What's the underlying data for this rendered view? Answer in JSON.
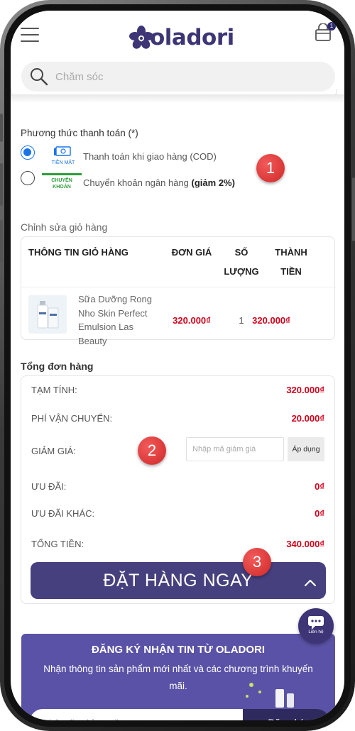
{
  "header": {
    "logo_text": "oladori",
    "cart_count": "1",
    "search_placeholder": "Chăm sóc"
  },
  "payment": {
    "title": "Phương thức thanh toán (*)",
    "options": [
      {
        "icon_caption": "TIỀN MẶT",
        "label": "Thanh toán khi giao hàng (COD)",
        "selected": true
      },
      {
        "icon_caption_1": "CHUYỂN",
        "icon_caption_2": "KHOẢN",
        "label": "Chuyển khoản ngân hàng",
        "label_bold": "(giảm 2%)",
        "selected": false
      }
    ]
  },
  "cart": {
    "edit_link": "Chỉnh sửa giỏ hàng",
    "headers": {
      "info": "THÔNG TIN GIỎ HÀNG",
      "unit_price": "ĐƠN GIÁ",
      "qty_1": "SỐ",
      "qty_2": "LƯỢNG",
      "total_1": "THÀNH",
      "total_2": "TIỀN"
    },
    "items": [
      {
        "name": "Sữa Dưỡng Rong Nho Skin Perfect Emulsion Las Beauty",
        "unit_price": "320.000₫",
        "quantity": "1",
        "total": "320.000₫"
      }
    ]
  },
  "summary": {
    "title": "Tổng đơn hàng",
    "subtotal_label": "TẠM TÍNH:",
    "subtotal": "320.000₫",
    "shipping_label": "PHÍ VẬN CHUYỂN:",
    "shipping": "20.000₫",
    "discount_label": "GIẢM GIÁ:",
    "coupon_placeholder": "Nhập mã giảm giá",
    "apply_label": "Áp dụng",
    "promo_label": "ƯU ĐÃI:",
    "promo": "0₫",
    "other_promo_label": "ƯU ĐÃI KHÁC:",
    "other_promo": "0₫",
    "total_label": "TỔNG TIỀN:",
    "total": "340.000₫",
    "order_button": "ĐẶT HÀNG NGAY"
  },
  "annotations": {
    "one": "1",
    "two": "2",
    "three": "3"
  },
  "chat": {
    "label": "Liên hệ"
  },
  "newsletter": {
    "title": "ĐĂNG KÝ NHẬN TIN TỪ OLADORI",
    "description": "Nhận thông tin sản phẩm mới nhất và các chương trình khuyến mãi.",
    "email_placeholder": "Nhập địa chỉ email",
    "button": "Đăng ký"
  },
  "colors": {
    "brand": "#3d3576",
    "price": "#d0021b",
    "radio": "#1a73e8",
    "annotation": "#d83333"
  }
}
